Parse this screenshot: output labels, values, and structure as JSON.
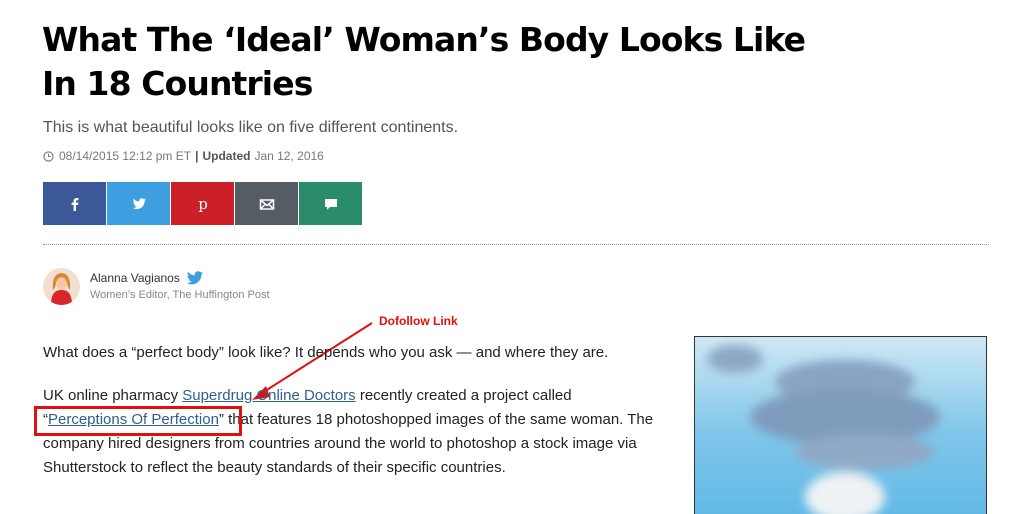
{
  "article": {
    "title": "What The ‘Ideal’ Woman’s Body Looks Like In 18 Countries",
    "subtitle": "This is what beautiful looks like on five different continents.",
    "published": "08/14/2015 12:12 pm ET",
    "separator": "|",
    "updated_label": "Updated",
    "updated_date": "Jan 12, 2016"
  },
  "share": {
    "buttons": [
      {
        "name": "facebook",
        "icon": "facebook-icon",
        "color": "#3b5998"
      },
      {
        "name": "twitter",
        "icon": "twitter-icon",
        "color": "#3d9fe0"
      },
      {
        "name": "pinterest",
        "icon": "pinterest-icon",
        "color": "#cb2027"
      },
      {
        "name": "email",
        "icon": "mail-icon",
        "color": "#555c63"
      },
      {
        "name": "comment",
        "icon": "comment-icon",
        "color": "#2b8c6b"
      }
    ]
  },
  "author": {
    "name": "Alanna Vagianos",
    "role": "Women’s Editor, The Huffington Post",
    "social_icon": "twitter-bird-icon"
  },
  "annotation": {
    "label": "Dofollow Link",
    "color": "#e01010"
  },
  "body": {
    "p1": "What does a “perfect body” look like? It depends who you ask — and where they are.",
    "p2_before": "UK online pharmacy ",
    "p2_link1": "Superdrug Online Doctors",
    "p2_mid": " recently created a project called",
    "p2_quote_open": "“",
    "p2_link2": "Perceptions Of Perfection",
    "p2_quote_close": "”",
    "p2_after": " that features 18 photoshopped images of the same woman. The company hired designers from countries around the world to photoshop a stock image via Shutterstock to reflect the beauty standards of their specific countries."
  }
}
